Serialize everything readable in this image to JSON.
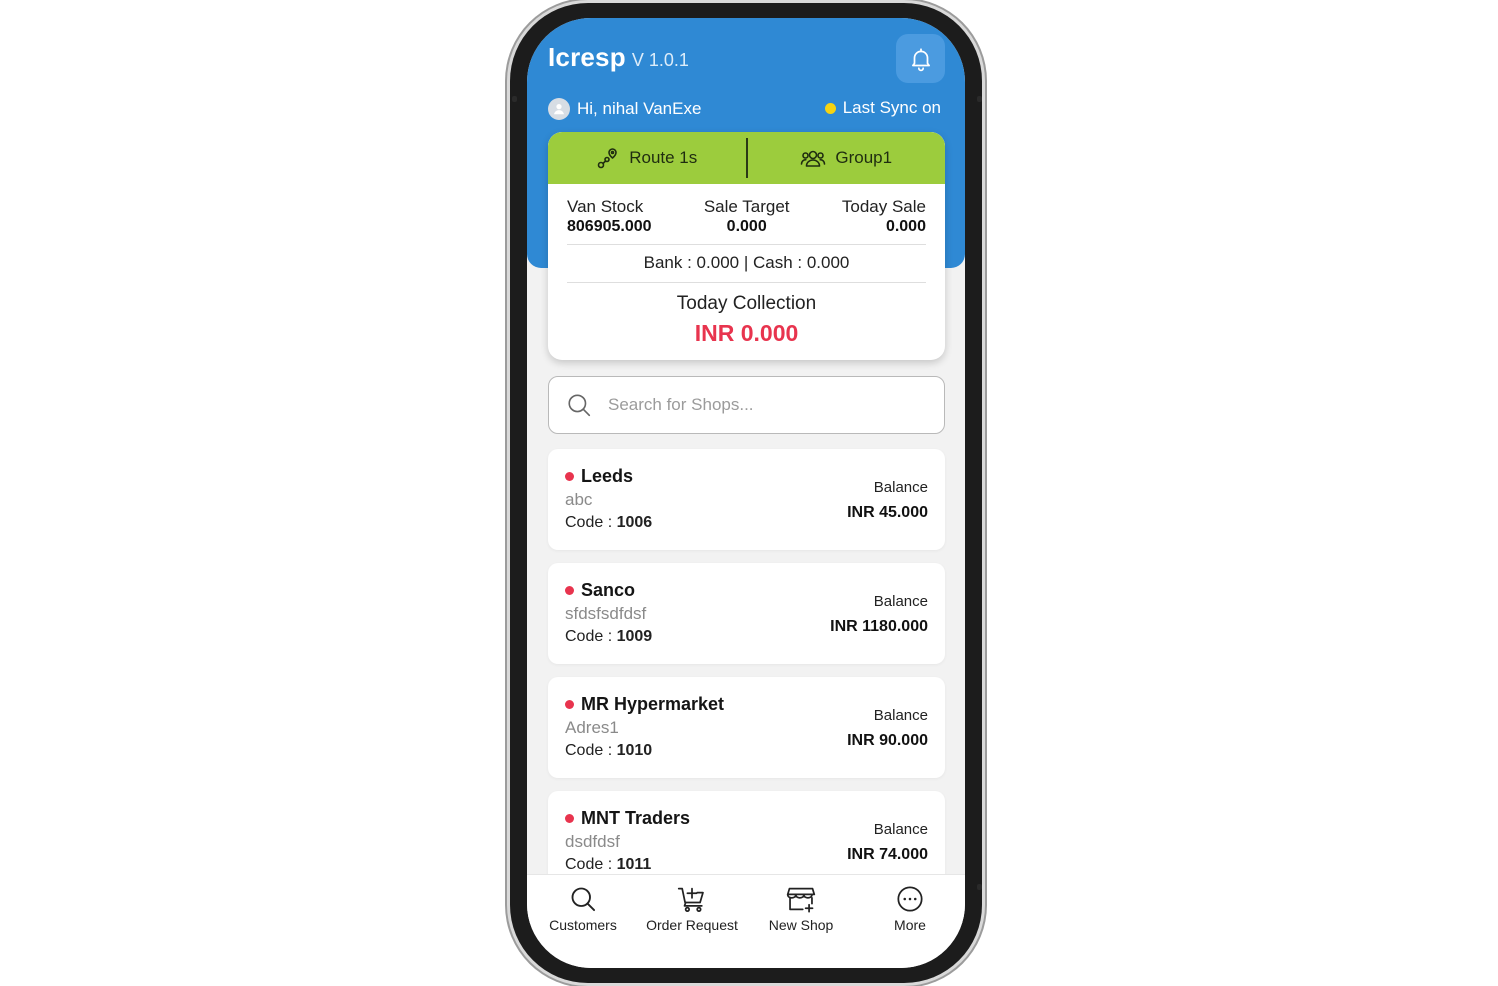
{
  "app": {
    "name": "Icresp",
    "version": "V 1.0.1"
  },
  "user": {
    "greeting": "Hi, nihal VanExe",
    "sync_text": "Last Sync on"
  },
  "route": {
    "route_label": "Route 1s",
    "group_label": "Group1"
  },
  "stats": {
    "van_stock_label": "Van Stock",
    "van_stock_value": "806905.000",
    "sale_target_label": "Sale Target",
    "sale_target_value": "0.000",
    "today_sale_label": "Today Sale",
    "today_sale_value": "0.000",
    "bank_cash": "Bank : 0.000 | Cash : 0.000",
    "collection_title": "Today Collection",
    "collection_value": "INR 0.000"
  },
  "search": {
    "placeholder": "Search for Shops..."
  },
  "shops": [
    {
      "name": "Leeds",
      "address": "abc",
      "code_label": "Code :",
      "code": "1006",
      "balance_label": "Balance",
      "balance": "INR 45.000"
    },
    {
      "name": "Sanco",
      "address": "sfdsfsdfdsf",
      "code_label": "Code :",
      "code": "1009",
      "balance_label": "Balance",
      "balance": "INR 1180.000"
    },
    {
      "name": "MR Hypermarket",
      "address": "Adres1",
      "code_label": "Code :",
      "code": "1010",
      "balance_label": "Balance",
      "balance": "INR 90.000"
    },
    {
      "name": "MNT Traders",
      "address": "dsdfdsf",
      "code_label": "Code :",
      "code": "1011",
      "balance_label": "Balance",
      "balance": "INR 74.000"
    }
  ],
  "nav": {
    "customers": "Customers",
    "order_request": "Order Request",
    "new_shop": "New Shop",
    "more": "More"
  },
  "colors": {
    "header_blue": "#2f89d4",
    "route_green": "#9ccc3d",
    "accent_red": "#e8344e",
    "sync_yellow": "#f5d312"
  },
  "icons": {
    "bell": "bell-icon",
    "avatar": "user-icon",
    "route": "route-icon",
    "group": "group-icon",
    "search": "search-icon",
    "nav_customers": "search-icon",
    "nav_order": "cart-plus-icon",
    "nav_new_shop": "store-plus-icon",
    "nav_more": "more-icon"
  }
}
